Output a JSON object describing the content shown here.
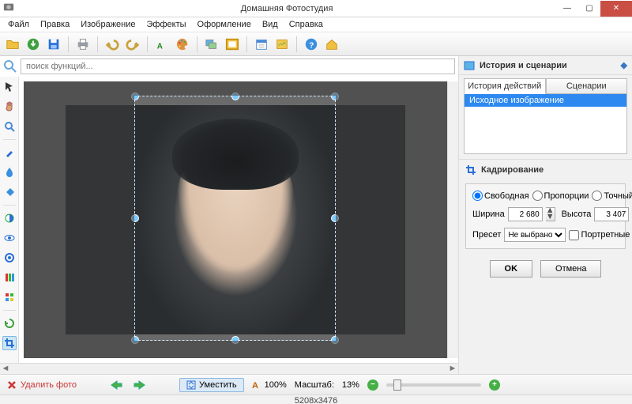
{
  "window": {
    "title": "Домашняя Фотостудия"
  },
  "menu": {
    "file": "Файл",
    "edit": "Правка",
    "image": "Изображение",
    "effects": "Эффекты",
    "design": "Оформление",
    "view": "Вид",
    "help": "Справка"
  },
  "search": {
    "placeholder": "поиск функций..."
  },
  "right": {
    "history_scenarios": "История и сценарии",
    "tab_history": "История действий",
    "tab_scenarios": "Сценарии",
    "history_item": "Исходное изображение",
    "crop_title": "Кадрирование",
    "radio_free": "Свободная",
    "radio_prop": "Пропорции",
    "radio_exact": "Точный размер",
    "width_label": "Ширина",
    "width_value": "2 680",
    "height_label": "Высота",
    "height_value": "3 407",
    "preset_label": "Пресет",
    "preset_value": "Не выбрано",
    "portrait_label": "Портретные",
    "ok": "OK",
    "cancel": "Отмена"
  },
  "bottom": {
    "delete": "Удалить фото",
    "fit": "Уместить",
    "zoom100": "100%",
    "scale_label": "Масштаб:",
    "scale_value": "13%"
  },
  "status": {
    "dims": "5208x3476"
  }
}
